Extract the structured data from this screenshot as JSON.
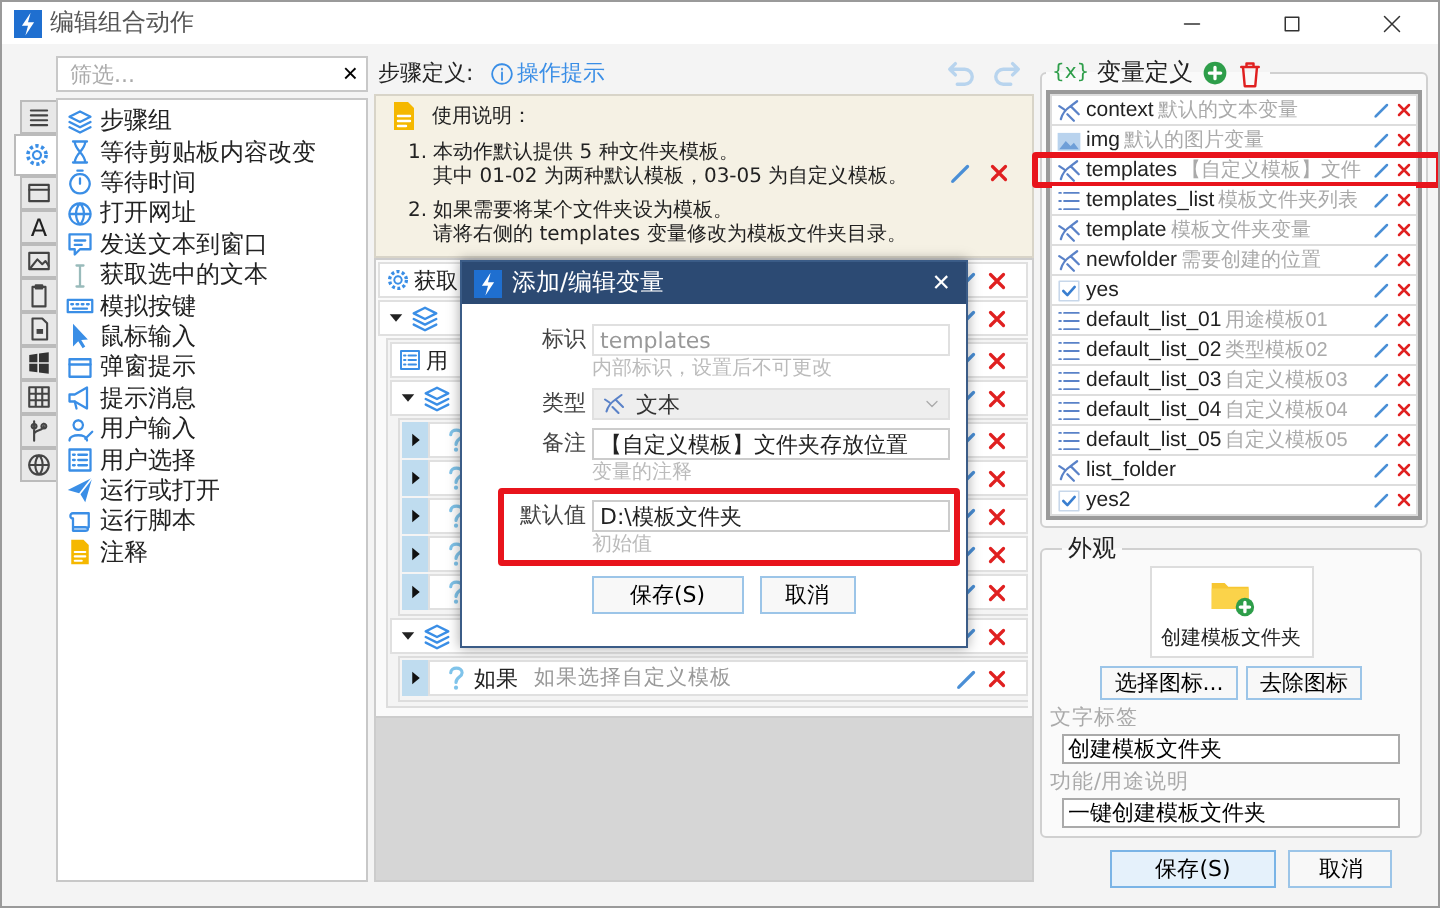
{
  "window": {
    "title": "编辑组合动作"
  },
  "filter": {
    "placeholder": "筛选...",
    "clear": "×"
  },
  "tabs": [
    {
      "kind": "lines",
      "selected": false
    },
    {
      "kind": "gear",
      "selected": true
    },
    {
      "kind": "window",
      "selected": false
    },
    {
      "kind": "letter",
      "label": "A",
      "selected": false
    },
    {
      "kind": "image",
      "selected": false
    },
    {
      "kind": "clipboard",
      "selected": false
    },
    {
      "kind": "doc",
      "selected": false
    },
    {
      "kind": "winlogo",
      "selected": false
    },
    {
      "kind": "table",
      "selected": false
    },
    {
      "kind": "branch",
      "selected": false
    },
    {
      "kind": "globe",
      "selected": false
    }
  ],
  "actions": [
    {
      "kind": "layers",
      "label": "步骤组"
    },
    {
      "kind": "hourglass",
      "label": "等待剪贴板内容改变"
    },
    {
      "kind": "stopwatch",
      "label": "等待时间"
    },
    {
      "kind": "globe",
      "label": "打开网址"
    },
    {
      "kind": "chat",
      "label": "发送文本到窗口"
    },
    {
      "kind": "cursor",
      "label": "获取选中的文本"
    },
    {
      "kind": "keyboard",
      "label": "模拟按键"
    },
    {
      "kind": "pointer",
      "label": "鼠标输入"
    },
    {
      "kind": "window",
      "label": "弹窗提示"
    },
    {
      "kind": "megaphone",
      "label": "提示消息"
    },
    {
      "kind": "user",
      "label": "用户输入"
    },
    {
      "kind": "listbox",
      "label": "用户选择"
    },
    {
      "kind": "plane",
      "label": "运行或打开"
    },
    {
      "kind": "scroll",
      "label": "运行脚本"
    },
    {
      "kind": "note",
      "label": "注释"
    }
  ],
  "steps_header": {
    "label": "步骤定义:",
    "hint_link": "操作提示"
  },
  "usage": {
    "title": "使用说明：",
    "items": [
      {
        "number": "1.",
        "lines": [
          "本动作默认提供 5 种文件夹模板。",
          "其中 01-02 为两种默认模板，03-05 为自定义模板。"
        ]
      },
      {
        "number": "2.",
        "lines": [
          "如果需要将某个文件夹设为模板。",
          "请将右侧的 templates 变量修改为模板文件夹目录。"
        ]
      }
    ]
  },
  "steps": [
    {
      "kind": "action",
      "title": "获取"
    },
    {
      "kind": "group",
      "expanded": true,
      "children": [
        {
          "kind": "action",
          "title": "用"
        },
        {
          "kind": "group",
          "expanded": true,
          "children": [
            {
              "kind": "condition",
              "expanded": false
            },
            {
              "kind": "condition",
              "expanded": false
            },
            {
              "kind": "condition",
              "expanded": false
            },
            {
              "kind": "condition",
              "expanded": false
            },
            {
              "kind": "condition",
              "expanded": false
            }
          ]
        },
        {
          "kind": "group",
          "expanded": true,
          "children": [
            {
              "kind": "condition",
              "expanded": false,
              "title": "如果",
              "note": "如果选择自定义模板"
            }
          ]
        }
      ]
    }
  ],
  "variables_panel": {
    "symbol": "{x}",
    "title": "变量定义"
  },
  "variables": [
    {
      "kind": "text",
      "name": "context",
      "comment": "默认的文本变量",
      "highlighted": false
    },
    {
      "kind": "image",
      "name": "img",
      "comment": "默认的图片变量",
      "highlighted": false
    },
    {
      "kind": "text",
      "name": "templates",
      "comment": "【自定义模板】文件",
      "highlighted": true
    },
    {
      "kind": "list",
      "name": "templates_list",
      "comment": "模板文件夹列表",
      "highlighted": false
    },
    {
      "kind": "text",
      "name": "template",
      "comment": "模板文件夹变量",
      "highlighted": false
    },
    {
      "kind": "text",
      "name": "newfolder",
      "comment": "需要创建的位置",
      "highlighted": false
    },
    {
      "kind": "bool",
      "name": "yes",
      "highlighted": false
    },
    {
      "kind": "list",
      "name": "default_list_01",
      "comment": "用途模板01",
      "highlighted": false
    },
    {
      "kind": "list",
      "name": "default_list_02",
      "comment": "类型模板02",
      "highlighted": false
    },
    {
      "kind": "list",
      "name": "default_list_03",
      "comment": "自定义模板03",
      "highlighted": false
    },
    {
      "kind": "list",
      "name": "default_list_04",
      "comment": "自定义模板04",
      "highlighted": false
    },
    {
      "kind": "list",
      "name": "default_list_05",
      "comment": "自定义模板05",
      "highlighted": false
    },
    {
      "kind": "text",
      "name": "list_folder",
      "highlighted": false
    },
    {
      "kind": "bool",
      "name": "yes2",
      "highlighted": false
    }
  ],
  "appearance": {
    "title": "外观",
    "preview_label": "创建模板文件夹",
    "choose_icon": "选择图标...",
    "remove_icon": "去除图标",
    "text_label": "文字标签",
    "text_value": "创建模板文件夹",
    "desc_label": "功能/用途说明",
    "desc_value": "一键创建模板文件夹"
  },
  "buttons": {
    "save": "保存(S)",
    "cancel": "取消"
  },
  "dialog": {
    "title": "添加/编辑变量",
    "close": "×",
    "fields": [
      {
        "kind": "text",
        "label": "标识",
        "value": "templates",
        "hint": "内部标识，设置后不可更改",
        "disabled": true,
        "highlighted": false
      },
      {
        "kind": "select",
        "label": "类型",
        "value": "文本",
        "disabled": true,
        "highlighted": false
      },
      {
        "kind": "text",
        "label": "备注",
        "value": "【自定义模板】文件夹存放位置",
        "hint": "变量的注释",
        "disabled": false,
        "highlighted": false
      },
      {
        "kind": "text",
        "label": "默认值",
        "value": "D:\\模板文件夹",
        "hint": "初始值",
        "disabled": false,
        "highlighted": true
      }
    ],
    "save": "保存(S)",
    "cancel": "取消"
  }
}
